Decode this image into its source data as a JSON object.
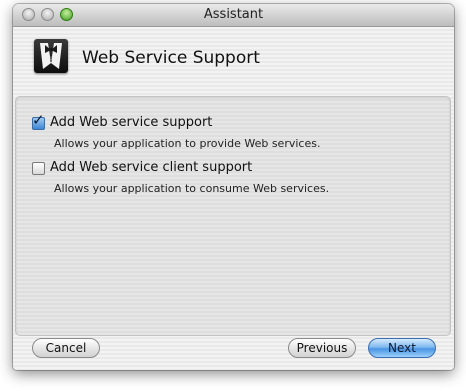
{
  "window": {
    "title": "Assistant"
  },
  "header": {
    "title": "Web Service Support",
    "icon": "tuxedo-icon"
  },
  "options": [
    {
      "label": "Add Web service support",
      "description": "Allows your application to provide Web services.",
      "checked": true
    },
    {
      "label": "Add Web service client support",
      "description": "Allows your application to consume Web services.",
      "checked": false
    }
  ],
  "buttons": {
    "cancel": "Cancel",
    "previous": "Previous",
    "next": "Next"
  },
  "colors": {
    "accent": "#4a95e4",
    "zoom_button": "#3c9a1e"
  }
}
